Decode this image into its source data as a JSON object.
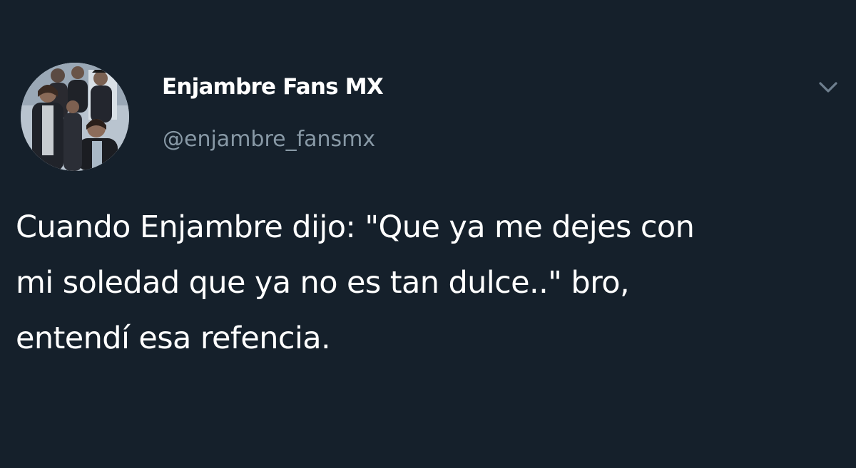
{
  "tweet": {
    "author": {
      "display_name": "Enjambre Fans MX",
      "handle": "@enjambre_fansmx",
      "avatar_icon": "band-photo-avatar"
    },
    "menu_icon": "chevron-down-icon",
    "text_lines": [
      "Cuando Enjambre dijo: \"Que ya me dejes con",
      "mi soledad que ya no es tan dulce..\" bro,",
      "entendí esa refencia."
    ]
  },
  "colors": {
    "background": "#15202b",
    "primary_text": "#ffffff",
    "secondary_text": "#8899a6"
  }
}
